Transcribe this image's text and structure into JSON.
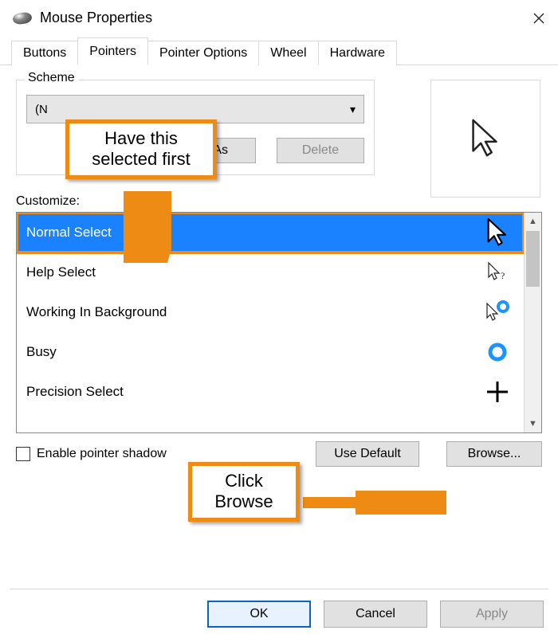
{
  "window": {
    "title": "Mouse Properties",
    "close_label": "Close"
  },
  "tabs": [
    {
      "label": "Buttons",
      "active": false
    },
    {
      "label": "Pointers",
      "active": true
    },
    {
      "label": "Pointer Options",
      "active": false
    },
    {
      "label": "Wheel",
      "active": false
    },
    {
      "label": "Hardware",
      "active": false
    }
  ],
  "scheme": {
    "legend": "Scheme",
    "selected_prefix": "(N",
    "save_as": "Save As...",
    "delete": "Delete"
  },
  "customize": {
    "label": "Customize:",
    "items": [
      {
        "label": "Normal Select",
        "selected": true,
        "cursor": "arrow-big"
      },
      {
        "label": "Help Select",
        "selected": false,
        "cursor": "arrow-help"
      },
      {
        "label": "Working In Background",
        "selected": false,
        "cursor": "arrow-ring"
      },
      {
        "label": "Busy",
        "selected": false,
        "cursor": "ring"
      },
      {
        "label": "Precision Select",
        "selected": false,
        "cursor": "crosshair"
      }
    ]
  },
  "shadow": {
    "label": "Enable pointer shadow"
  },
  "buttons": {
    "use_default": "Use Default",
    "browse": "Browse...",
    "ok": "OK",
    "cancel": "Cancel",
    "apply": "Apply"
  },
  "annotations": {
    "a1": "Have this\nselected first",
    "a2": "Click\nBrowse"
  }
}
